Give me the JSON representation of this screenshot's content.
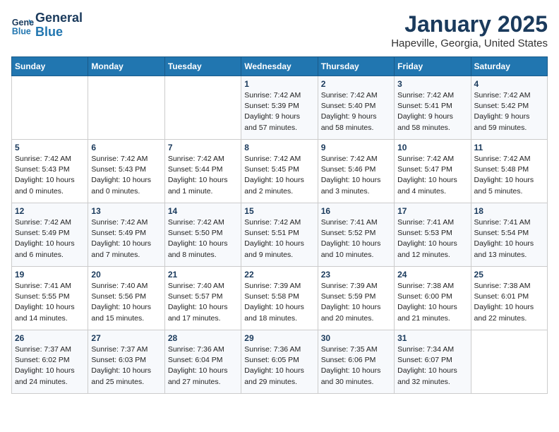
{
  "header": {
    "logo_line1": "General",
    "logo_line2": "Blue",
    "title": "January 2025",
    "subtitle": "Hapeville, Georgia, United States"
  },
  "days_of_week": [
    "Sunday",
    "Monday",
    "Tuesday",
    "Wednesday",
    "Thursday",
    "Friday",
    "Saturday"
  ],
  "weeks": [
    [
      {
        "day": "",
        "info": ""
      },
      {
        "day": "",
        "info": ""
      },
      {
        "day": "",
        "info": ""
      },
      {
        "day": "1",
        "info": "Sunrise: 7:42 AM\nSunset: 5:39 PM\nDaylight: 9 hours\nand 57 minutes."
      },
      {
        "day": "2",
        "info": "Sunrise: 7:42 AM\nSunset: 5:40 PM\nDaylight: 9 hours\nand 58 minutes."
      },
      {
        "day": "3",
        "info": "Sunrise: 7:42 AM\nSunset: 5:41 PM\nDaylight: 9 hours\nand 58 minutes."
      },
      {
        "day": "4",
        "info": "Sunrise: 7:42 AM\nSunset: 5:42 PM\nDaylight: 9 hours\nand 59 minutes."
      }
    ],
    [
      {
        "day": "5",
        "info": "Sunrise: 7:42 AM\nSunset: 5:43 PM\nDaylight: 10 hours\nand 0 minutes."
      },
      {
        "day": "6",
        "info": "Sunrise: 7:42 AM\nSunset: 5:43 PM\nDaylight: 10 hours\nand 0 minutes."
      },
      {
        "day": "7",
        "info": "Sunrise: 7:42 AM\nSunset: 5:44 PM\nDaylight: 10 hours\nand 1 minute."
      },
      {
        "day": "8",
        "info": "Sunrise: 7:42 AM\nSunset: 5:45 PM\nDaylight: 10 hours\nand 2 minutes."
      },
      {
        "day": "9",
        "info": "Sunrise: 7:42 AM\nSunset: 5:46 PM\nDaylight: 10 hours\nand 3 minutes."
      },
      {
        "day": "10",
        "info": "Sunrise: 7:42 AM\nSunset: 5:47 PM\nDaylight: 10 hours\nand 4 minutes."
      },
      {
        "day": "11",
        "info": "Sunrise: 7:42 AM\nSunset: 5:48 PM\nDaylight: 10 hours\nand 5 minutes."
      }
    ],
    [
      {
        "day": "12",
        "info": "Sunrise: 7:42 AM\nSunset: 5:49 PM\nDaylight: 10 hours\nand 6 minutes."
      },
      {
        "day": "13",
        "info": "Sunrise: 7:42 AM\nSunset: 5:49 PM\nDaylight: 10 hours\nand 7 minutes."
      },
      {
        "day": "14",
        "info": "Sunrise: 7:42 AM\nSunset: 5:50 PM\nDaylight: 10 hours\nand 8 minutes."
      },
      {
        "day": "15",
        "info": "Sunrise: 7:42 AM\nSunset: 5:51 PM\nDaylight: 10 hours\nand 9 minutes."
      },
      {
        "day": "16",
        "info": "Sunrise: 7:41 AM\nSunset: 5:52 PM\nDaylight: 10 hours\nand 10 minutes."
      },
      {
        "day": "17",
        "info": "Sunrise: 7:41 AM\nSunset: 5:53 PM\nDaylight: 10 hours\nand 12 minutes."
      },
      {
        "day": "18",
        "info": "Sunrise: 7:41 AM\nSunset: 5:54 PM\nDaylight: 10 hours\nand 13 minutes."
      }
    ],
    [
      {
        "day": "19",
        "info": "Sunrise: 7:41 AM\nSunset: 5:55 PM\nDaylight: 10 hours\nand 14 minutes."
      },
      {
        "day": "20",
        "info": "Sunrise: 7:40 AM\nSunset: 5:56 PM\nDaylight: 10 hours\nand 15 minutes."
      },
      {
        "day": "21",
        "info": "Sunrise: 7:40 AM\nSunset: 5:57 PM\nDaylight: 10 hours\nand 17 minutes."
      },
      {
        "day": "22",
        "info": "Sunrise: 7:39 AM\nSunset: 5:58 PM\nDaylight: 10 hours\nand 18 minutes."
      },
      {
        "day": "23",
        "info": "Sunrise: 7:39 AM\nSunset: 5:59 PM\nDaylight: 10 hours\nand 20 minutes."
      },
      {
        "day": "24",
        "info": "Sunrise: 7:38 AM\nSunset: 6:00 PM\nDaylight: 10 hours\nand 21 minutes."
      },
      {
        "day": "25",
        "info": "Sunrise: 7:38 AM\nSunset: 6:01 PM\nDaylight: 10 hours\nand 22 minutes."
      }
    ],
    [
      {
        "day": "26",
        "info": "Sunrise: 7:37 AM\nSunset: 6:02 PM\nDaylight: 10 hours\nand 24 minutes."
      },
      {
        "day": "27",
        "info": "Sunrise: 7:37 AM\nSunset: 6:03 PM\nDaylight: 10 hours\nand 25 minutes."
      },
      {
        "day": "28",
        "info": "Sunrise: 7:36 AM\nSunset: 6:04 PM\nDaylight: 10 hours\nand 27 minutes."
      },
      {
        "day": "29",
        "info": "Sunrise: 7:36 AM\nSunset: 6:05 PM\nDaylight: 10 hours\nand 29 minutes."
      },
      {
        "day": "30",
        "info": "Sunrise: 7:35 AM\nSunset: 6:06 PM\nDaylight: 10 hours\nand 30 minutes."
      },
      {
        "day": "31",
        "info": "Sunrise: 7:34 AM\nSunset: 6:07 PM\nDaylight: 10 hours\nand 32 minutes."
      },
      {
        "day": "",
        "info": ""
      }
    ]
  ]
}
